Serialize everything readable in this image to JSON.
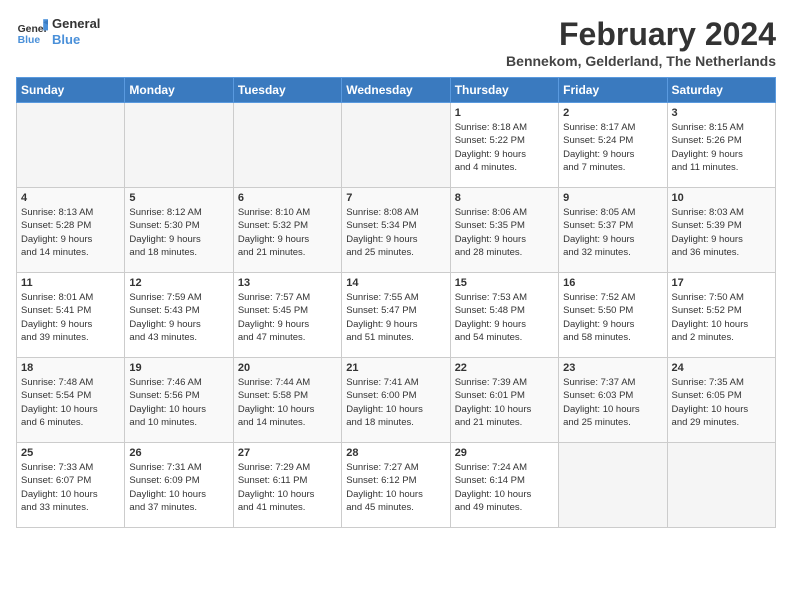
{
  "logo": {
    "line1": "General",
    "line2": "Blue"
  },
  "title": {
    "month_year": "February 2024",
    "location": "Bennekom, Gelderland, The Netherlands"
  },
  "weekdays": [
    "Sunday",
    "Monday",
    "Tuesday",
    "Wednesday",
    "Thursday",
    "Friday",
    "Saturday"
  ],
  "weeks": [
    [
      {
        "day": "",
        "info": ""
      },
      {
        "day": "",
        "info": ""
      },
      {
        "day": "",
        "info": ""
      },
      {
        "day": "",
        "info": ""
      },
      {
        "day": "1",
        "info": "Sunrise: 8:18 AM\nSunset: 5:22 PM\nDaylight: 9 hours\nand 4 minutes."
      },
      {
        "day": "2",
        "info": "Sunrise: 8:17 AM\nSunset: 5:24 PM\nDaylight: 9 hours\nand 7 minutes."
      },
      {
        "day": "3",
        "info": "Sunrise: 8:15 AM\nSunset: 5:26 PM\nDaylight: 9 hours\nand 11 minutes."
      }
    ],
    [
      {
        "day": "4",
        "info": "Sunrise: 8:13 AM\nSunset: 5:28 PM\nDaylight: 9 hours\nand 14 minutes."
      },
      {
        "day": "5",
        "info": "Sunrise: 8:12 AM\nSunset: 5:30 PM\nDaylight: 9 hours\nand 18 minutes."
      },
      {
        "day": "6",
        "info": "Sunrise: 8:10 AM\nSunset: 5:32 PM\nDaylight: 9 hours\nand 21 minutes."
      },
      {
        "day": "7",
        "info": "Sunrise: 8:08 AM\nSunset: 5:34 PM\nDaylight: 9 hours\nand 25 minutes."
      },
      {
        "day": "8",
        "info": "Sunrise: 8:06 AM\nSunset: 5:35 PM\nDaylight: 9 hours\nand 28 minutes."
      },
      {
        "day": "9",
        "info": "Sunrise: 8:05 AM\nSunset: 5:37 PM\nDaylight: 9 hours\nand 32 minutes."
      },
      {
        "day": "10",
        "info": "Sunrise: 8:03 AM\nSunset: 5:39 PM\nDaylight: 9 hours\nand 36 minutes."
      }
    ],
    [
      {
        "day": "11",
        "info": "Sunrise: 8:01 AM\nSunset: 5:41 PM\nDaylight: 9 hours\nand 39 minutes."
      },
      {
        "day": "12",
        "info": "Sunrise: 7:59 AM\nSunset: 5:43 PM\nDaylight: 9 hours\nand 43 minutes."
      },
      {
        "day": "13",
        "info": "Sunrise: 7:57 AM\nSunset: 5:45 PM\nDaylight: 9 hours\nand 47 minutes."
      },
      {
        "day": "14",
        "info": "Sunrise: 7:55 AM\nSunset: 5:47 PM\nDaylight: 9 hours\nand 51 minutes."
      },
      {
        "day": "15",
        "info": "Sunrise: 7:53 AM\nSunset: 5:48 PM\nDaylight: 9 hours\nand 54 minutes."
      },
      {
        "day": "16",
        "info": "Sunrise: 7:52 AM\nSunset: 5:50 PM\nDaylight: 9 hours\nand 58 minutes."
      },
      {
        "day": "17",
        "info": "Sunrise: 7:50 AM\nSunset: 5:52 PM\nDaylight: 10 hours\nand 2 minutes."
      }
    ],
    [
      {
        "day": "18",
        "info": "Sunrise: 7:48 AM\nSunset: 5:54 PM\nDaylight: 10 hours\nand 6 minutes."
      },
      {
        "day": "19",
        "info": "Sunrise: 7:46 AM\nSunset: 5:56 PM\nDaylight: 10 hours\nand 10 minutes."
      },
      {
        "day": "20",
        "info": "Sunrise: 7:44 AM\nSunset: 5:58 PM\nDaylight: 10 hours\nand 14 minutes."
      },
      {
        "day": "21",
        "info": "Sunrise: 7:41 AM\nSunset: 6:00 PM\nDaylight: 10 hours\nand 18 minutes."
      },
      {
        "day": "22",
        "info": "Sunrise: 7:39 AM\nSunset: 6:01 PM\nDaylight: 10 hours\nand 21 minutes."
      },
      {
        "day": "23",
        "info": "Sunrise: 7:37 AM\nSunset: 6:03 PM\nDaylight: 10 hours\nand 25 minutes."
      },
      {
        "day": "24",
        "info": "Sunrise: 7:35 AM\nSunset: 6:05 PM\nDaylight: 10 hours\nand 29 minutes."
      }
    ],
    [
      {
        "day": "25",
        "info": "Sunrise: 7:33 AM\nSunset: 6:07 PM\nDaylight: 10 hours\nand 33 minutes."
      },
      {
        "day": "26",
        "info": "Sunrise: 7:31 AM\nSunset: 6:09 PM\nDaylight: 10 hours\nand 37 minutes."
      },
      {
        "day": "27",
        "info": "Sunrise: 7:29 AM\nSunset: 6:11 PM\nDaylight: 10 hours\nand 41 minutes."
      },
      {
        "day": "28",
        "info": "Sunrise: 7:27 AM\nSunset: 6:12 PM\nDaylight: 10 hours\nand 45 minutes."
      },
      {
        "day": "29",
        "info": "Sunrise: 7:24 AM\nSunset: 6:14 PM\nDaylight: 10 hours\nand 49 minutes."
      },
      {
        "day": "",
        "info": ""
      },
      {
        "day": "",
        "info": ""
      }
    ]
  ]
}
